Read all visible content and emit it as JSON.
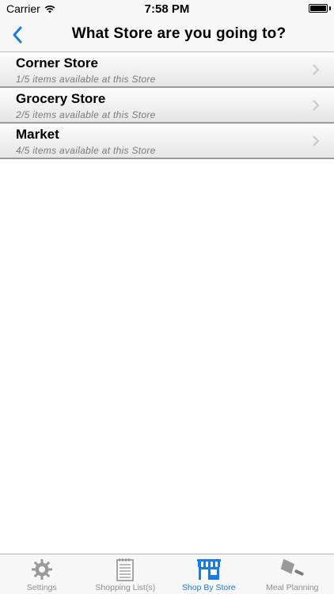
{
  "status_bar": {
    "carrier": "Carrier",
    "time": "7:58 PM",
    "battery_level": 1.0
  },
  "nav_bar": {
    "title": "What Store are you going to?",
    "back_icon": "chevron-left-icon"
  },
  "stores": [
    {
      "name": "Corner Store",
      "availability": "1/5 items available at this Store"
    },
    {
      "name": "Grocery Store",
      "availability": "2/5 items available at this Store"
    },
    {
      "name": "Market",
      "availability": "4/5 items available at this Store"
    }
  ],
  "tab_bar": {
    "active_tab": "Shop By Store",
    "accent_color": "#1a7ae6",
    "inactive_color": "#8e8e8e",
    "tabs": [
      {
        "label": "Settings",
        "icon": "gear-icon"
      },
      {
        "label": "Shopping List(s)",
        "icon": "notepad-icon"
      },
      {
        "label": "Shop By Store",
        "icon": "storefront-icon"
      },
      {
        "label": "Meal Planning",
        "icon": "cleaver-icon"
      }
    ]
  }
}
